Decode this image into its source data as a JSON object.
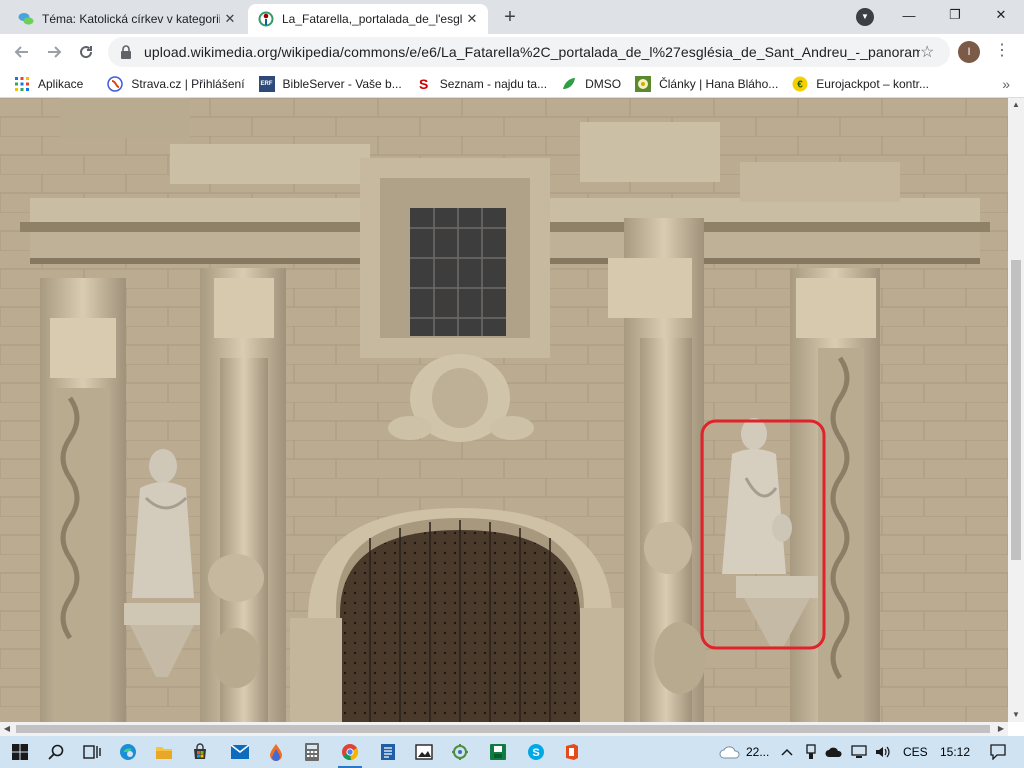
{
  "browser": {
    "tabs": [
      {
        "title": "Téma: Katolická církev v kategorii",
        "active": false,
        "favicon": "chat-bubbles-icon"
      },
      {
        "title": "La_Fatarella,_portalada_de_l'esglé",
        "active": true,
        "favicon": "wikimedia-icon"
      }
    ],
    "new_tab": "+",
    "close_glyph": "✕",
    "window_controls": {
      "minimize": "—",
      "restore": "❐",
      "close": "✕"
    },
    "url": "upload.wikimedia.org/wikipedia/commons/e/e6/La_Fatarella%2C_portalada_de_l%27església_de_Sant_Andreu_-_panorami...",
    "profile_initial": "I"
  },
  "bookmarks": [
    {
      "label": "Aplikace",
      "icon": "apps-grid-icon"
    },
    {
      "label": "Strava.cz | Přihlášení",
      "icon": "strava-icon"
    },
    {
      "label": "BibleServer - Vaše b...",
      "icon": "bibleserver-icon"
    },
    {
      "label": "Seznam - najdu ta...",
      "icon": "seznam-icon"
    },
    {
      "label": "DMSO",
      "icon": "dmso-icon"
    },
    {
      "label": "Články | Hana Bláho...",
      "icon": "flower-icon"
    },
    {
      "label": "Eurojackpot – kontr...",
      "icon": "eurojackpot-icon"
    }
  ],
  "bookmarks_more": "»",
  "taskbar": {
    "weather": "22...",
    "language": "CES",
    "time": "15:12"
  },
  "colors": {
    "highlight": "#e0232b",
    "tabstrip": "#dee1e6",
    "taskbar": "#cfe3f3"
  }
}
